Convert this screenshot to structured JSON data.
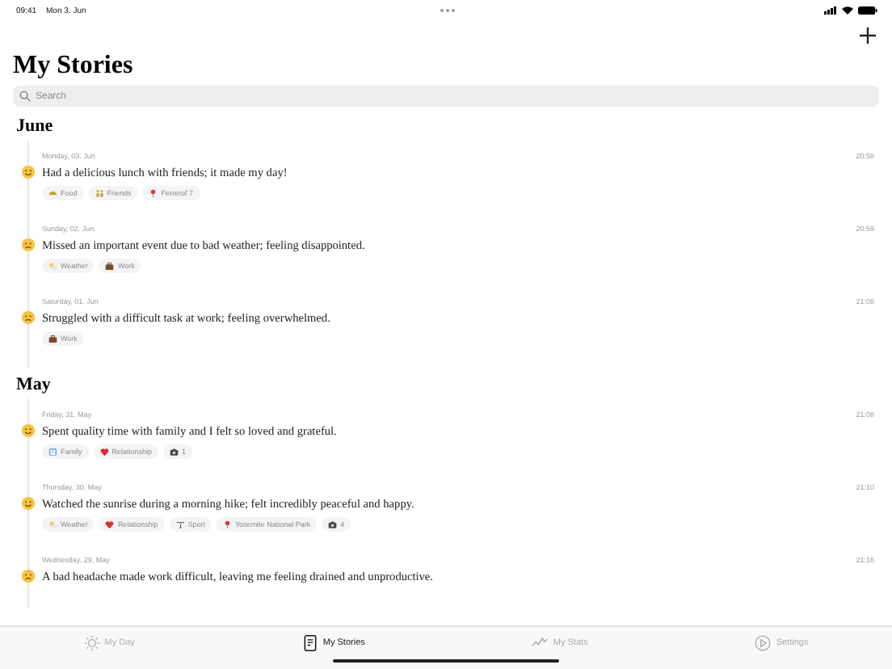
{
  "status_bar": {
    "time": "09:41",
    "date": "Mon 3. Jun"
  },
  "title": "My Stories",
  "search": {
    "placeholder": "Search"
  },
  "sections": [
    {
      "title": "June",
      "entries": [
        {
          "date": "Monday, 03. Jun",
          "time": "20:58",
          "kind": "happy",
          "text": "Had a delicious lunch with friends; it made my day!",
          "tags": [
            {
              "kind": "food",
              "label": "Food"
            },
            {
              "kind": "people",
              "label": "Friends"
            },
            {
              "kind": "pin",
              "label": "Ferrerof 7"
            }
          ]
        },
        {
          "date": "Sunday, 02. Jun",
          "time": "20:59",
          "kind": "sad",
          "text": "Missed an important event due to bad weather; feeling disappointed.",
          "tags": [
            {
              "kind": "weather",
              "label": "Weather"
            },
            {
              "kind": "work",
              "label": "Work"
            }
          ]
        },
        {
          "date": "Saturday, 01. Jun",
          "time": "21:08",
          "kind": "sad",
          "text": "Struggled with a difficult task at work; feeling overwhelmed.",
          "tags": [
            {
              "kind": "work",
              "label": "Work"
            }
          ]
        }
      ]
    },
    {
      "title": "May",
      "entries": [
        {
          "date": "Friday, 31. May",
          "time": "21:08",
          "kind": "happy",
          "text": "Spent quality time with family and I felt so loved and grateful.",
          "tags": [
            {
              "kind": "family",
              "label": "Family"
            },
            {
              "kind": "heart",
              "label": "Relationship"
            },
            {
              "kind": "camera",
              "label": "1"
            }
          ]
        },
        {
          "date": "Thursday, 30. May",
          "time": "21:10",
          "kind": "happy",
          "text": "Watched the sunrise during a morning hike; felt incredibly peaceful and happy.",
          "tags": [
            {
              "kind": "weather",
              "label": "Weather"
            },
            {
              "kind": "heart",
              "label": "Relationship"
            },
            {
              "kind": "sport",
              "label": "Sport"
            },
            {
              "kind": "pin",
              "label": "Yosemite National Park"
            },
            {
              "kind": "camera",
              "label": "4"
            }
          ]
        },
        {
          "date": "Wednesday, 29. May",
          "time": "21:16",
          "kind": "sad",
          "text": "A bad headache made work difficult, leaving me feeling drained and unproductive."
        }
      ]
    }
  ],
  "tab_bar": [
    {
      "kind": "day",
      "label": "My Day",
      "selected": false
    },
    {
      "kind": "stories",
      "label": "My Stories",
      "selected": true
    },
    {
      "kind": "stats",
      "label": "My Stats",
      "selected": false
    },
    {
      "kind": "settings",
      "label": "Settings",
      "selected": false
    }
  ]
}
